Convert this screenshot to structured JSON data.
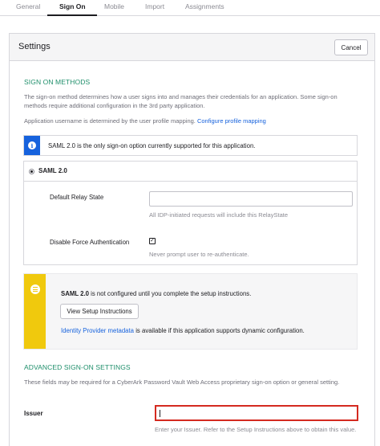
{
  "tabs": [
    "General",
    "Sign On",
    "Mobile",
    "Import",
    "Assignments"
  ],
  "settings": {
    "title": "Settings",
    "cancel_label": "Cancel"
  },
  "sign_on": {
    "heading": "SIGN ON METHODS",
    "description": "The sign-on method determines how a user signs into and manages their credentials for an application. Some sign-on methods require additional configuration in the 3rd party application.",
    "username_text": "Application username is determined by the user profile mapping.",
    "configure_link": "Configure profile mapping",
    "info_text": "SAML 2.0 is the only sign-on option currently supported for this application."
  },
  "saml": {
    "label": "SAML 2.0",
    "relay_label": "Default Relay State",
    "relay_value": "",
    "relay_hint": "All IDP-initiated requests will include this RelayState",
    "force_auth_label": "Disable Force Authentication",
    "force_auth_checked": true,
    "force_auth_hint": "Never prompt user to re-authenticate."
  },
  "warning": {
    "bold": "SAML 2.0",
    "text": "is not configured until you complete the setup instructions.",
    "button_label": "View Setup Instructions",
    "metadata_link": "Identity Provider metadata",
    "metadata_text": "is available if this application supports dynamic configuration."
  },
  "advanced": {
    "heading": "ADVANCED SIGN-ON SETTINGS",
    "description": "These fields may be required for a CyberArk Password Vault Web Access proprietary sign-on option or general setting.",
    "issuer_label": "Issuer",
    "issuer_value": "",
    "issuer_hint": "Enter your Issuer. Refer to the Setup Instructions above to obtain this value."
  },
  "colors": {
    "accent_green": "#1f8f6b",
    "link_blue": "#1662dd",
    "info_blue": "#1662dd",
    "warning_yellow": "#f0c90d",
    "highlight_red": "#d42a20"
  },
  "icons": [
    "info-icon",
    "radio-selected-icon",
    "checkbox-checked-icon",
    "setup-list-icon"
  ]
}
